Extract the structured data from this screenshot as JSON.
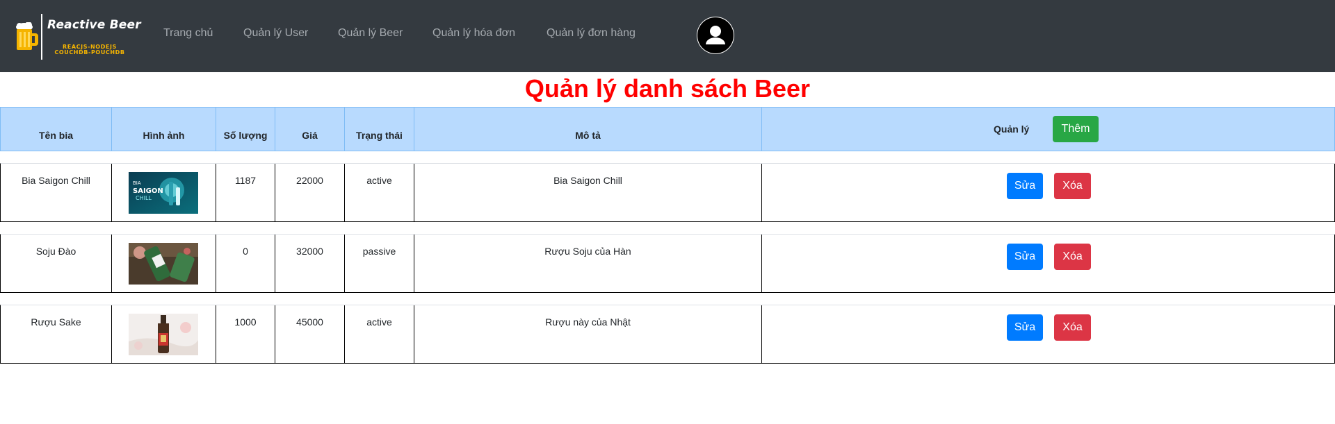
{
  "navbar": {
    "brand_title": "Reactive Beer",
    "brand_sub_1": "REACJS-NODEJS",
    "brand_sub_2": "COUCHDB-POUCHDB",
    "links": [
      "Trang chủ",
      "Quản lý User",
      "Quản lý Beer",
      "Quản lý hóa đơn",
      "Quản lý đơn hàng"
    ]
  },
  "page_title": "Quản lý danh sách Beer",
  "table": {
    "headers": [
      "Tên bia",
      "Hình ảnh",
      "Số lượng",
      "Giá",
      "Trạng thái",
      "Mô tả",
      "Quản lý"
    ],
    "add_label": "Thêm",
    "edit_label": "Sửa",
    "delete_label": "Xóa",
    "rows": [
      {
        "name": "Bia Saigon Chill",
        "image": "bia-saigon-chill-image",
        "quantity": "1187",
        "price": "22000",
        "status": "active",
        "description": "Bia Saigon Chill"
      },
      {
        "name": "Soju Đào",
        "image": "soju-dao-image",
        "quantity": "0",
        "price": "32000",
        "status": "passive",
        "description": "Rượu Soju của Hàn"
      },
      {
        "name": "Rượu Sake",
        "image": "ruou-sake-image",
        "quantity": "1000",
        "price": "45000",
        "status": "active",
        "description": "Rượu này của Nhật"
      }
    ]
  },
  "colors": {
    "navbar_bg": "#343a40",
    "title_red": "#ff0000",
    "header_bg": "#b8dafe",
    "add_green": "#28a745",
    "edit_blue": "#007bff",
    "delete_red": "#dc3545"
  }
}
